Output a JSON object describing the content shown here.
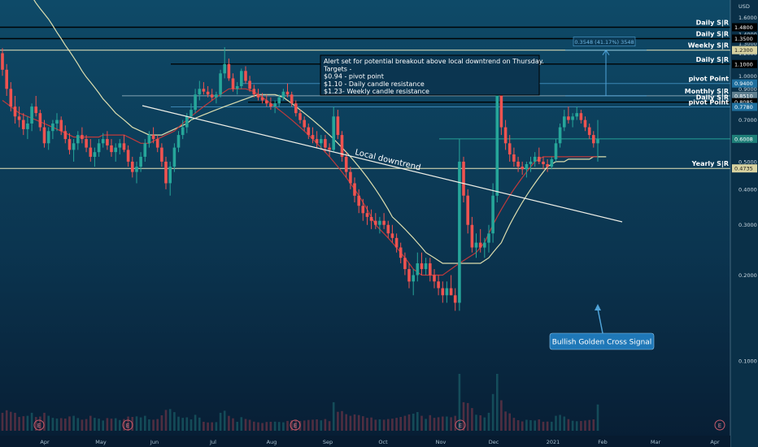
{
  "chart_data": {
    "type": "candlestick",
    "currency": "USD",
    "x_labels": [
      "Apr",
      "May",
      "Jun",
      "Jul",
      "Aug",
      "Sep",
      "Oct",
      "Nov",
      "Dec",
      "2021",
      "Feb",
      "Mar",
      "Apr"
    ],
    "y_ticks": [
      "1.6000",
      "1.5000",
      "1.4000",
      "1.3000",
      "1.2000",
      "1.1000",
      "1.0000",
      "0.9000",
      "0.8000",
      "0.7000",
      "0.6000",
      "0.5000",
      "0.4000",
      "0.3000",
      "0.2000",
      "0.1000"
    ],
    "ylim": [
      0.06,
      1.75
    ],
    "scale": "log",
    "levels": [
      {
        "label": "Daily S|R",
        "price_label": "1.4800",
        "value": 1.48,
        "color": "#000000"
      },
      {
        "label": "Daily S|R",
        "price_label": "1.3500",
        "value": 1.35,
        "color": "#000000"
      },
      {
        "label": "Weekly S|R",
        "price_label": "1.2300",
        "value": 1.23,
        "color": "#f5f0c0"
      },
      {
        "label": "Daily S|R",
        "price_label": "1.1000",
        "value": 1.1,
        "color": "#000000"
      },
      {
        "label": "pivot Point",
        "price_label": "0.9400",
        "value": 0.94,
        "color": "#4fa3d8"
      },
      {
        "label": "Monthly S|R",
        "price_label": "0.8510",
        "value": 0.851,
        "color": "#8aa9b8"
      },
      {
        "label": "Daily S|R",
        "price_label": "0.8085",
        "value": 0.8085,
        "color": "#000000"
      },
      {
        "label": "pivot Point",
        "price_label": "0.7780",
        "value": 0.778,
        "color": "#4fa3d8"
      },
      {
        "label": "",
        "price_label": "0.6008",
        "value": 0.6008,
        "color": "#26a69a"
      },
      {
        "label": "Yearly S|R",
        "price_label": "0.4735",
        "value": 0.4735,
        "color": "#f5f0c0"
      }
    ],
    "annotation": {
      "lines": [
        "Alert set for potential breakout above local downtrend on Thursday.",
        "Targets -",
        "$0.94 - pivot point",
        "$1.10 - Daily candle resistance",
        "$1.23- Weekly candle resistance"
      ]
    },
    "trendline_label": "Local downtrend",
    "measure_label": "0.3548 (41.17%) 3548",
    "callout": "Bullish Golden Cross Signal",
    "earnings_marker": "E",
    "candles": [
      [
        1.2,
        1.25,
        1.0,
        1.05
      ],
      [
        1.05,
        1.1,
        0.85,
        0.9
      ],
      [
        0.9,
        0.95,
        0.75,
        0.78
      ],
      [
        0.78,
        0.85,
        0.68,
        0.72
      ],
      [
        0.72,
        0.78,
        0.66,
        0.7
      ],
      [
        0.7,
        0.74,
        0.62,
        0.65
      ],
      [
        0.65,
        0.72,
        0.6,
        0.68
      ],
      [
        0.68,
        0.8,
        0.64,
        0.78
      ],
      [
        0.78,
        0.85,
        0.72,
        0.74
      ],
      [
        0.74,
        0.76,
        0.64,
        0.66
      ],
      [
        0.66,
        0.7,
        0.56,
        0.58
      ],
      [
        0.58,
        0.66,
        0.55,
        0.64
      ],
      [
        0.64,
        0.7,
        0.6,
        0.68
      ],
      [
        0.68,
        0.74,
        0.64,
        0.7
      ],
      [
        0.7,
        0.72,
        0.62,
        0.64
      ],
      [
        0.64,
        0.67,
        0.58,
        0.6
      ],
      [
        0.6,
        0.63,
        0.53,
        0.55
      ],
      [
        0.55,
        0.6,
        0.5,
        0.58
      ],
      [
        0.58,
        0.64,
        0.55,
        0.62
      ],
      [
        0.62,
        0.66,
        0.58,
        0.6
      ],
      [
        0.6,
        0.62,
        0.54,
        0.56
      ],
      [
        0.56,
        0.6,
        0.5,
        0.52
      ],
      [
        0.52,
        0.56,
        0.48,
        0.54
      ],
      [
        0.54,
        0.6,
        0.52,
        0.58
      ],
      [
        0.58,
        0.63,
        0.56,
        0.6
      ],
      [
        0.6,
        0.64,
        0.55,
        0.57
      ],
      [
        0.57,
        0.6,
        0.52,
        0.54
      ],
      [
        0.54,
        0.58,
        0.5,
        0.56
      ],
      [
        0.56,
        0.6,
        0.53,
        0.58
      ],
      [
        0.58,
        0.62,
        0.54,
        0.55
      ],
      [
        0.55,
        0.57,
        0.48,
        0.5
      ],
      [
        0.5,
        0.52,
        0.44,
        0.46
      ],
      [
        0.46,
        0.5,
        0.42,
        0.48
      ],
      [
        0.48,
        0.54,
        0.46,
        0.52
      ],
      [
        0.52,
        0.6,
        0.5,
        0.58
      ],
      [
        0.58,
        0.64,
        0.56,
        0.62
      ],
      [
        0.62,
        0.66,
        0.58,
        0.6
      ],
      [
        0.6,
        0.62,
        0.54,
        0.56
      ],
      [
        0.56,
        0.58,
        0.48,
        0.5
      ],
      [
        0.5,
        0.52,
        0.4,
        0.42
      ],
      [
        0.42,
        0.5,
        0.38,
        0.48
      ],
      [
        0.48,
        0.58,
        0.46,
        0.56
      ],
      [
        0.56,
        0.64,
        0.54,
        0.62
      ],
      [
        0.62,
        0.7,
        0.6,
        0.66
      ],
      [
        0.66,
        0.74,
        0.63,
        0.72
      ],
      [
        0.72,
        0.8,
        0.7,
        0.76
      ],
      [
        0.76,
        0.9,
        0.74,
        0.86
      ],
      [
        0.86,
        0.96,
        0.82,
        0.9
      ],
      [
        0.9,
        0.95,
        0.86,
        0.88
      ],
      [
        0.88,
        0.92,
        0.84,
        0.86
      ],
      [
        0.86,
        0.9,
        0.82,
        0.84
      ],
      [
        0.84,
        0.88,
        0.8,
        0.86
      ],
      [
        0.86,
        1.05,
        0.84,
        1.02
      ],
      [
        1.02,
        1.26,
        0.98,
        1.1
      ],
      [
        1.1,
        1.15,
        0.96,
        0.98
      ],
      [
        0.98,
        1.02,
        0.88,
        0.9
      ],
      [
        0.9,
        0.95,
        0.86,
        0.92
      ],
      [
        0.92,
        1.06,
        0.9,
        1.04
      ],
      [
        1.04,
        1.08,
        0.94,
        0.96
      ],
      [
        0.96,
        1.0,
        0.88,
        0.9
      ],
      [
        0.9,
        0.93,
        0.84,
        0.86
      ],
      [
        0.86,
        0.9,
        0.82,
        0.84
      ],
      [
        0.84,
        0.87,
        0.8,
        0.82
      ],
      [
        0.82,
        0.86,
        0.78,
        0.8
      ],
      [
        0.8,
        0.84,
        0.76,
        0.78
      ],
      [
        0.78,
        0.82,
        0.74,
        0.8
      ],
      [
        0.8,
        0.86,
        0.78,
        0.84
      ],
      [
        0.84,
        0.9,
        0.82,
        0.88
      ],
      [
        0.88,
        0.94,
        0.84,
        0.86
      ],
      [
        0.86,
        0.88,
        0.78,
        0.8
      ],
      [
        0.8,
        0.82,
        0.72,
        0.74
      ],
      [
        0.74,
        0.76,
        0.68,
        0.7
      ],
      [
        0.7,
        0.72,
        0.64,
        0.66
      ],
      [
        0.66,
        0.68,
        0.6,
        0.62
      ],
      [
        0.62,
        0.66,
        0.58,
        0.6
      ],
      [
        0.6,
        0.64,
        0.56,
        0.58
      ],
      [
        0.58,
        0.62,
        0.55,
        0.6
      ],
      [
        0.6,
        0.62,
        0.54,
        0.56
      ],
      [
        0.56,
        0.58,
        0.52,
        0.55
      ],
      [
        0.55,
        0.78,
        0.54,
        0.72
      ],
      [
        0.72,
        0.76,
        0.6,
        0.62
      ],
      [
        0.62,
        0.64,
        0.5,
        0.52
      ],
      [
        0.52,
        0.54,
        0.44,
        0.46
      ],
      [
        0.46,
        0.48,
        0.4,
        0.42
      ],
      [
        0.42,
        0.44,
        0.36,
        0.38
      ],
      [
        0.38,
        0.4,
        0.33,
        0.35
      ],
      [
        0.35,
        0.37,
        0.31,
        0.33
      ],
      [
        0.33,
        0.35,
        0.3,
        0.32
      ],
      [
        0.32,
        0.34,
        0.29,
        0.31
      ],
      [
        0.31,
        0.33,
        0.29,
        0.3
      ],
      [
        0.3,
        0.32,
        0.28,
        0.31
      ],
      [
        0.31,
        0.33,
        0.29,
        0.3
      ],
      [
        0.3,
        0.31,
        0.27,
        0.28
      ],
      [
        0.28,
        0.3,
        0.26,
        0.27
      ],
      [
        0.27,
        0.28,
        0.24,
        0.25
      ],
      [
        0.25,
        0.26,
        0.22,
        0.23
      ],
      [
        0.23,
        0.24,
        0.2,
        0.21
      ],
      [
        0.21,
        0.22,
        0.18,
        0.19
      ],
      [
        0.19,
        0.21,
        0.17,
        0.2
      ],
      [
        0.2,
        0.24,
        0.19,
        0.22
      ],
      [
        0.22,
        0.24,
        0.2,
        0.21
      ],
      [
        0.21,
        0.23,
        0.2,
        0.22
      ],
      [
        0.22,
        0.23,
        0.19,
        0.2
      ],
      [
        0.2,
        0.21,
        0.18,
        0.19
      ],
      [
        0.19,
        0.2,
        0.17,
        0.18
      ],
      [
        0.18,
        0.19,
        0.16,
        0.17
      ],
      [
        0.17,
        0.19,
        0.16,
        0.18
      ],
      [
        0.18,
        0.2,
        0.17,
        0.17
      ],
      [
        0.17,
        0.18,
        0.15,
        0.16
      ],
      [
        0.16,
        0.6,
        0.15,
        0.5
      ],
      [
        0.5,
        0.52,
        0.36,
        0.38
      ],
      [
        0.38,
        0.4,
        0.28,
        0.3
      ],
      [
        0.3,
        0.32,
        0.24,
        0.25
      ],
      [
        0.25,
        0.28,
        0.23,
        0.26
      ],
      [
        0.26,
        0.29,
        0.24,
        0.25
      ],
      [
        0.25,
        0.27,
        0.23,
        0.26
      ],
      [
        0.26,
        0.3,
        0.24,
        0.28
      ],
      [
        0.28,
        0.42,
        0.26,
        0.38
      ],
      [
        0.38,
        0.96,
        0.36,
        0.88
      ],
      [
        0.88,
        0.92,
        0.62,
        0.66
      ],
      [
        0.66,
        0.7,
        0.55,
        0.58
      ],
      [
        0.58,
        0.62,
        0.5,
        0.53
      ],
      [
        0.53,
        0.56,
        0.48,
        0.5
      ],
      [
        0.5,
        0.52,
        0.46,
        0.48
      ],
      [
        0.48,
        0.5,
        0.45,
        0.47
      ],
      [
        0.47,
        0.5,
        0.44,
        0.49
      ],
      [
        0.49,
        0.52,
        0.46,
        0.5
      ],
      [
        0.5,
        0.54,
        0.48,
        0.52
      ],
      [
        0.52,
        0.56,
        0.49,
        0.5
      ],
      [
        0.5,
        0.52,
        0.47,
        0.49
      ],
      [
        0.49,
        0.51,
        0.46,
        0.48
      ],
      [
        0.48,
        0.52,
        0.47,
        0.51
      ],
      [
        0.51,
        0.6,
        0.5,
        0.58
      ],
      [
        0.58,
        0.68,
        0.56,
        0.66
      ],
      [
        0.66,
        0.76,
        0.64,
        0.72
      ],
      [
        0.72,
        0.78,
        0.68,
        0.7
      ],
      [
        0.7,
        0.74,
        0.66,
        0.72
      ],
      [
        0.72,
        0.78,
        0.7,
        0.74
      ],
      [
        0.74,
        0.76,
        0.68,
        0.7
      ],
      [
        0.7,
        0.72,
        0.64,
        0.66
      ],
      [
        0.66,
        0.68,
        0.6,
        0.62
      ],
      [
        0.62,
        0.64,
        0.56,
        0.58
      ],
      [
        0.58,
        0.7,
        0.5,
        0.6
      ]
    ],
    "ma_fast": [
      0.82,
      0.8,
      0.78,
      0.76,
      0.74,
      0.73,
      0.72,
      0.71,
      0.7,
      0.69,
      0.68,
      0.67,
      0.66,
      0.65,
      0.64,
      0.63,
      0.62,
      0.61,
      0.61,
      0.61,
      0.61,
      0.61,
      0.61,
      0.61,
      0.62,
      0.62,
      0.62,
      0.62,
      0.62,
      0.62,
      0.61,
      0.6,
      0.59,
      0.58,
      0.58,
      0.58,
      0.59,
      0.6,
      0.61,
      0.62,
      0.63,
      0.64,
      0.66,
      0.68,
      0.7,
      0.72,
      0.74,
      0.76,
      0.78,
      0.8,
      0.82,
      0.84,
      0.86,
      0.88,
      0.9,
      0.9,
      0.9,
      0.9,
      0.9,
      0.89,
      0.88,
      0.86,
      0.84,
      0.82,
      0.8,
      0.78,
      0.76,
      0.74,
      0.72,
      0.7,
      0.68,
      0.66,
      0.64,
      0.62,
      0.6,
      0.58,
      0.56,
      0.54,
      0.52,
      0.5,
      0.48,
      0.46,
      0.44,
      0.42,
      0.4,
      0.38,
      0.36,
      0.34,
      0.32,
      0.3,
      0.29,
      0.28,
      0.27,
      0.26,
      0.25,
      0.24,
      0.23,
      0.22,
      0.21,
      0.205,
      0.2,
      0.2,
      0.2,
      0.2,
      0.2,
      0.2,
      0.205,
      0.21,
      0.215,
      0.22,
      0.225,
      0.23,
      0.235,
      0.24,
      0.25,
      0.26,
      0.28,
      0.3,
      0.32,
      0.34,
      0.36,
      0.38,
      0.4,
      0.42,
      0.44,
      0.46,
      0.48,
      0.5,
      0.51,
      0.52,
      0.52,
      0.52,
      0.52,
      0.52,
      0.52,
      0.52,
      0.52,
      0.52,
      0.52,
      0.52,
      0.52,
      0.52,
      0.52
    ],
    "ma_slow": [
      2.6,
      2.5,
      2.4,
      2.3,
      2.2,
      2.1,
      2.0,
      1.9,
      1.8,
      1.72,
      1.65,
      1.58,
      1.5,
      1.42,
      1.35,
      1.28,
      1.22,
      1.16,
      1.1,
      1.04,
      0.99,
      0.95,
      0.91,
      0.87,
      0.83,
      0.8,
      0.77,
      0.74,
      0.72,
      0.7,
      0.68,
      0.66,
      0.65,
      0.64,
      0.63,
      0.62,
      0.62,
      0.62,
      0.62,
      0.63,
      0.64,
      0.65,
      0.66,
      0.67,
      0.68,
      0.7,
      0.71,
      0.72,
      0.73,
      0.74,
      0.75,
      0.76,
      0.77,
      0.78,
      0.79,
      0.8,
      0.81,
      0.82,
      0.83,
      0.84,
      0.85,
      0.86,
      0.86,
      0.86,
      0.86,
      0.86,
      0.85,
      0.84,
      0.82,
      0.8,
      0.78,
      0.76,
      0.74,
      0.72,
      0.7,
      0.68,
      0.66,
      0.64,
      0.62,
      0.6,
      0.58,
      0.56,
      0.54,
      0.52,
      0.5,
      0.48,
      0.46,
      0.44,
      0.42,
      0.4,
      0.38,
      0.36,
      0.34,
      0.32,
      0.31,
      0.3,
      0.29,
      0.28,
      0.27,
      0.26,
      0.25,
      0.24,
      0.235,
      0.23,
      0.225,
      0.22,
      0.22,
      0.22,
      0.22,
      0.22,
      0.22,
      0.22,
      0.22,
      0.22,
      0.22,
      0.225,
      0.23,
      0.24,
      0.25,
      0.26,
      0.28,
      0.3,
      0.32,
      0.34,
      0.36,
      0.38,
      0.4,
      0.42,
      0.44,
      0.46,
      0.48,
      0.49,
      0.5,
      0.5,
      0.5,
      0.51,
      0.51,
      0.51,
      0.51,
      0.51,
      0.51,
      0.52,
      0.52,
      0.52,
      0.52
    ]
  }
}
